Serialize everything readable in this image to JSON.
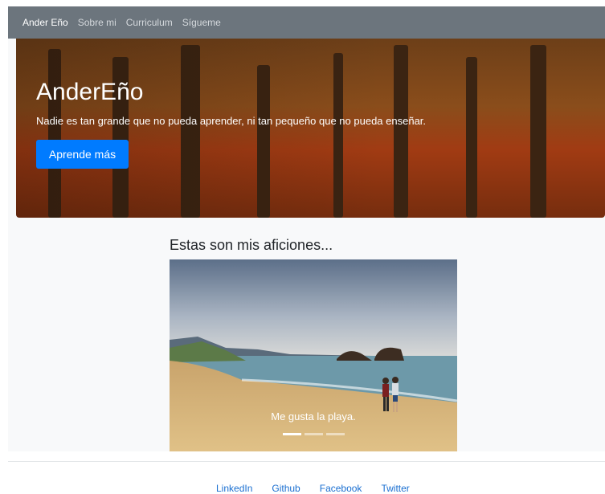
{
  "navbar": {
    "brand": "Ander Eño",
    "links": [
      "Sobre mi",
      "Curriculum",
      "Sígueme"
    ]
  },
  "hero": {
    "title": "AnderEño",
    "subtitle": "Nadie es tan grande que no pueda aprender, ni tan pequeño que no pueda enseñar.",
    "button_label": "Aprende más"
  },
  "hobbies": {
    "heading": "Estas son mis aficiones...",
    "carousel": {
      "caption": "Me gusta la playa.",
      "slide_count": 3,
      "active_index": 0
    }
  },
  "footer": {
    "links": [
      "LinkedIn",
      "Github",
      "Facebook",
      "Twitter"
    ]
  },
  "colors": {
    "navbar": "#6c757d",
    "primary": "#007bff",
    "link": "#1a6fd1",
    "section_bg": "#f8f9fa"
  }
}
